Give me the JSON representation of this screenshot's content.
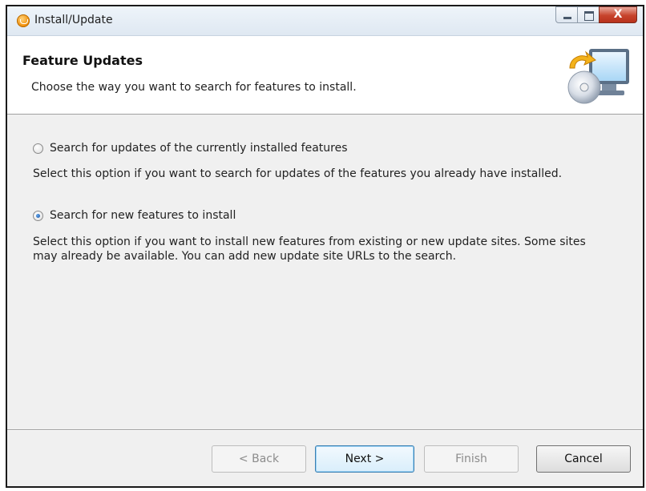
{
  "window": {
    "title": "Install/Update",
    "icon": "eclipse-install-icon",
    "controls": {
      "minimize": "minimize-icon",
      "maximize": "maximize-icon",
      "close_glyph": "X"
    }
  },
  "banner": {
    "title": "Feature Updates",
    "description": "Choose the way you want to search for features to install.",
    "image": "install-wizard-icon"
  },
  "options": [
    {
      "label": "Search for updates of the currently installed features",
      "description": "Select this option if you want to search for updates of the features you already have installed.",
      "selected": false
    },
    {
      "label": "Search for new features to install",
      "description_line1": "Select this option if you want to install new features from existing or new update sites. Some sites",
      "description_line2": "may already be available. You can add new update site URLs to the search.",
      "selected": true
    }
  ],
  "buttons": {
    "back": "< Back",
    "next": "Next >",
    "finish": "Finish",
    "cancel": "Cancel"
  },
  "colors": {
    "accent": "#3c7fb1",
    "radio_selected": "#1c4f9b",
    "close_button": "#c7432c"
  }
}
